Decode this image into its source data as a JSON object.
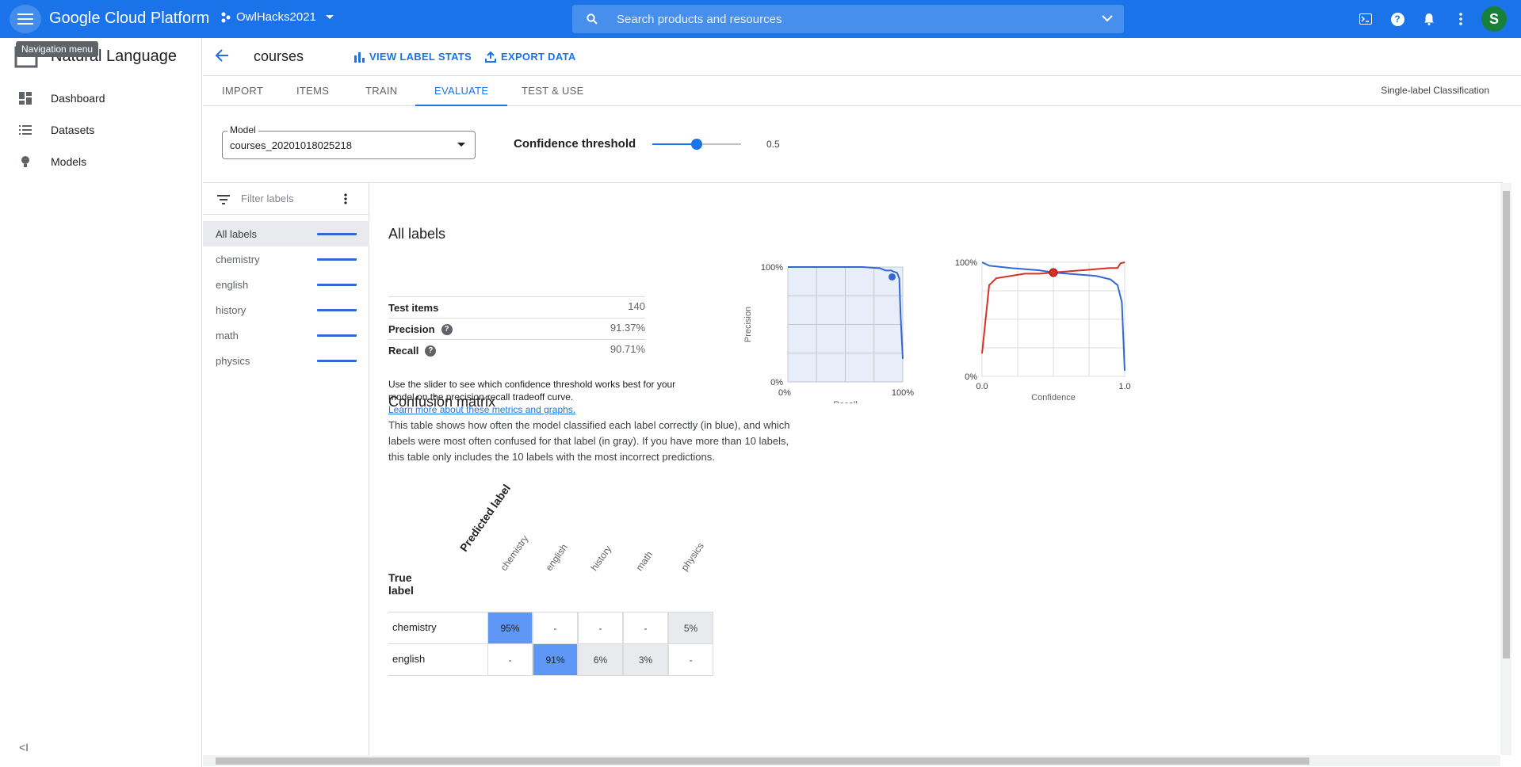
{
  "topbar": {
    "brand": "Google Cloud Platform",
    "project": "OwlHacks2021",
    "search_placeholder": "Search products and resources",
    "avatar_letter": "S",
    "tooltip": "Navigation menu"
  },
  "sidebar": {
    "product": "Natural Language",
    "items": [
      {
        "label": "Dashboard",
        "icon": "dashboard-icon"
      },
      {
        "label": "Datasets",
        "icon": "list-icon"
      },
      {
        "label": "Models",
        "icon": "lightbulb-icon"
      }
    ]
  },
  "header": {
    "title": "courses",
    "view_label_stats": "VIEW LABEL STATS",
    "export_data": "EXPORT DATA"
  },
  "tabs": [
    "IMPORT",
    "ITEMS",
    "TRAIN",
    "EVALUATE",
    "TEST & USE"
  ],
  "active_tab": "EVALUATE",
  "model_type": "Single-label Classification",
  "model_select": {
    "label": "Model",
    "value": "courses_20201018025218"
  },
  "confidence": {
    "label": "Confidence threshold",
    "value": "0.5",
    "fraction": 0.5
  },
  "filter_placeholder": "Filter labels",
  "labels": [
    "All labels",
    "chemistry",
    "english",
    "history",
    "math",
    "physics"
  ],
  "all_labels": {
    "title": "All labels",
    "metrics": [
      {
        "key": "Test items",
        "value": "140",
        "help": false
      },
      {
        "key": "Precision",
        "value": "91.37%",
        "help": true
      },
      {
        "key": "Recall",
        "value": "90.71%",
        "help": true
      }
    ],
    "description": "Use the slider to see which confidence threshold works best for your model on the precision-recall tradeoff curve.",
    "link": "Learn more about these metrics and graphs."
  },
  "chart_data": [
    {
      "type": "area",
      "xlabel": "Recall",
      "ylabel": "Precision",
      "xticks": [
        "0%",
        "100%"
      ],
      "yticks": [
        "0%",
        "100%"
      ],
      "x": [
        0,
        0.2,
        0.4,
        0.6,
        0.65,
        0.8,
        0.85,
        0.9,
        0.92,
        0.95,
        0.97,
        0.98,
        1.0
      ],
      "y": [
        1,
        1,
        1,
        1,
        1,
        0.99,
        0.97,
        0.97,
        0.96,
        0.95,
        0.9,
        0.6,
        0.2
      ],
      "marker": {
        "x": 0.907,
        "y": 0.914
      }
    },
    {
      "type": "line",
      "xlabel": "Confidence",
      "xticks": [
        "0.0",
        "1.0"
      ],
      "yticks": [
        "0%",
        "100%"
      ],
      "series": [
        {
          "name": "Recall",
          "color": "#3367d6",
          "x": [
            0,
            0.05,
            0.2,
            0.4,
            0.5,
            0.6,
            0.8,
            0.9,
            0.95,
            0.98,
            1.0
          ],
          "y": [
            1.0,
            0.97,
            0.95,
            0.93,
            0.91,
            0.9,
            0.88,
            0.85,
            0.8,
            0.65,
            0.05
          ]
        },
        {
          "name": "Precision",
          "color": "#d93025",
          "x": [
            0,
            0.05,
            0.1,
            0.2,
            0.3,
            0.4,
            0.5,
            0.6,
            0.7,
            0.8,
            0.9,
            0.95,
            0.97,
            1.0
          ],
          "y": [
            0.2,
            0.8,
            0.86,
            0.88,
            0.9,
            0.9,
            0.91,
            0.92,
            0.93,
            0.94,
            0.95,
            0.95,
            0.99,
            1.0
          ]
        }
      ],
      "marker": {
        "x": 0.5,
        "y": 0.91
      }
    }
  ],
  "confusion": {
    "title": "Confusion matrix",
    "description": "This table shows how often the model classified each label correctly (in blue), and which labels were most often confused for that label (in gray). If you have more than 10 labels, this table only includes the 10 labels with the most incorrect predictions.",
    "true_label": "True label",
    "predicted_label": "Predicted label",
    "columns": [
      "chemistry",
      "english",
      "history",
      "math",
      "physics"
    ],
    "rows": [
      {
        "label": "chemistry",
        "cells": [
          "95%",
          "-",
          "-",
          "-",
          "5%"
        ]
      },
      {
        "label": "english",
        "cells": [
          "-",
          "91%",
          "6%",
          "3%",
          "-"
        ]
      }
    ]
  }
}
